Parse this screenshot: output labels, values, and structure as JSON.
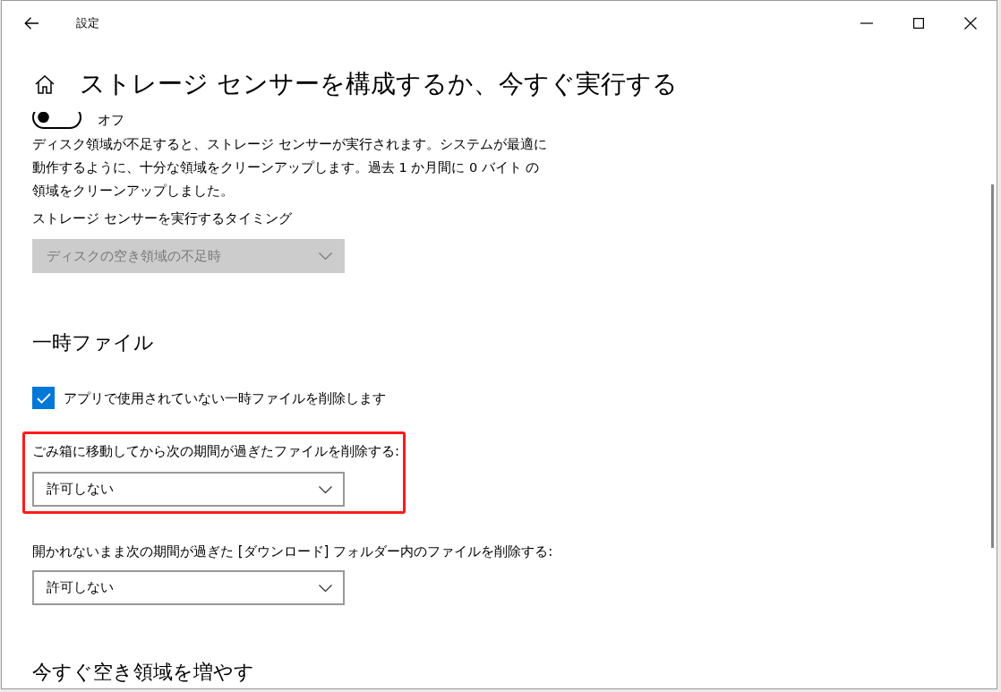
{
  "window": {
    "title": "設定"
  },
  "page": {
    "heading": "ストレージ センサーを構成するか、今すぐ実行する"
  },
  "storage_sense": {
    "toggle": {
      "on": false,
      "label": "オフ"
    },
    "description": "ディスク領域が不足すると、ストレージ センサーが実行されます。システムが最適に動作するように、十分な領域をクリーンアップします。過去 1 か月間に 0 バイト の領域をクリーンアップしました。",
    "timing": {
      "label": "ストレージ センサーを実行するタイミング",
      "value": "ディスクの空き領域の不足時",
      "disabled": true
    }
  },
  "temporary_files": {
    "heading": "一時ファイル",
    "checkbox": {
      "label": "アプリで使用されていない一時ファイルを削除します",
      "checked": true
    },
    "settings": [
      {
        "label": "ごみ箱に移動してから次の期間が過ぎたファイルを削除する:",
        "value": "許可しない",
        "disabled": false,
        "highlighted": true
      },
      {
        "label": "開かれないまま次の期間が過ぎた [ダウンロード] フォルダー内のファイルを削除する:",
        "value": "許可しない",
        "disabled": false,
        "highlighted": false
      }
    ]
  },
  "free_up_now": {
    "heading": "今すぐ空き領域を増やす"
  }
}
